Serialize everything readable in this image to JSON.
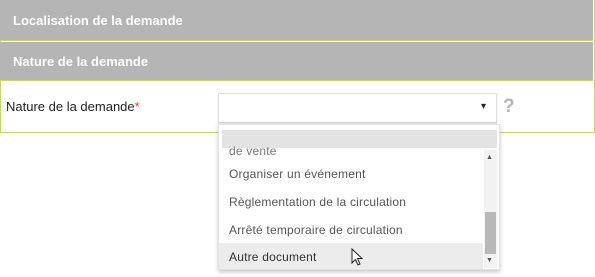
{
  "sections": {
    "localisation": "Localisation de la demande",
    "nature": "Nature de la demande"
  },
  "field": {
    "label": "Nature de la demande",
    "required_marker": "*",
    "value": "",
    "caret": "▾",
    "help": "?"
  },
  "dropdown": {
    "options": [
      "de vente",
      "Organiser un événement",
      "Règlementation de la circulation",
      "Arrêté temporaire de circulation",
      "Autre document"
    ],
    "highlighted_index": 4
  },
  "scrollbar": {
    "up": "▲",
    "down": "▼"
  },
  "colors": {
    "section_bg": "#b5b5b5",
    "frame_border": "#c5d96a",
    "required": "#e53935"
  }
}
